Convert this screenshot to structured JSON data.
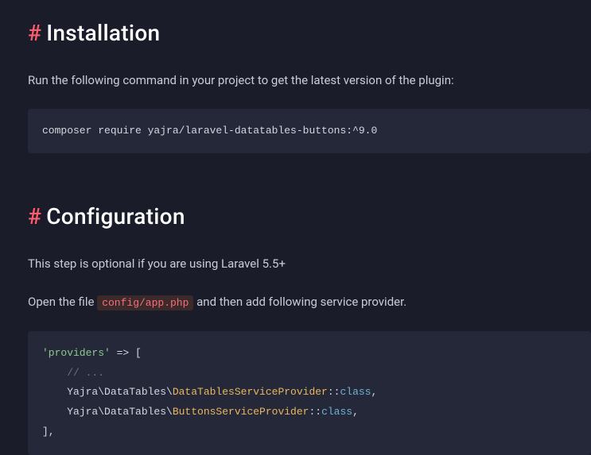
{
  "installation": {
    "hash": "#",
    "title": "Installation",
    "intro": "Run the following command in your project to get the latest version of the plugin:",
    "cmd": "composer require yajra/laravel-datatables-buttons:^9.0"
  },
  "configuration": {
    "hash": "#",
    "title": "Configuration",
    "intro": "This step is optional if you are using Laravel 5.5+",
    "open_prefix": "Open the file ",
    "file": "config/app.php",
    "open_suffix": " and then add following service provider.",
    "code": {
      "l1_str": "'providers'",
      "l1_rest": " => [",
      "l2": "    // ...",
      "l3_ns": "    Yajra\\DataTables\\",
      "l3_cls": "DataTablesServiceProvider",
      "l3_colon": "::",
      "l3_kw": "class",
      "l3_end": ",",
      "l4_ns": "    Yajra\\DataTables\\",
      "l4_cls": "ButtonsServiceProvider",
      "l4_colon": "::",
      "l4_kw": "class",
      "l4_end": ",",
      "l5": "],"
    }
  }
}
